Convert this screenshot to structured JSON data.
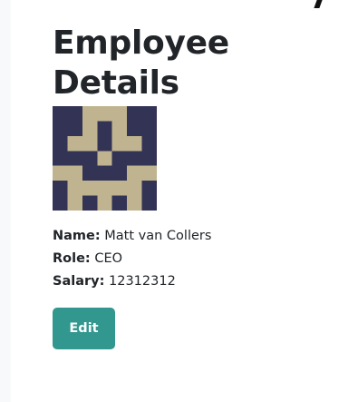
{
  "page": {
    "title": "Employee Details"
  },
  "avatar": {
    "icon": "identicon-avatar",
    "background": "#333355",
    "foreground": "#bfb48f"
  },
  "employee": {
    "name_label": "Name:",
    "name": "Matt van Collers",
    "role_label": "Role:",
    "role": "CEO",
    "salary_label": "Salary:",
    "salary": "12312312"
  },
  "actions": {
    "edit_label": "Edit",
    "edit_color": "#31978f"
  }
}
